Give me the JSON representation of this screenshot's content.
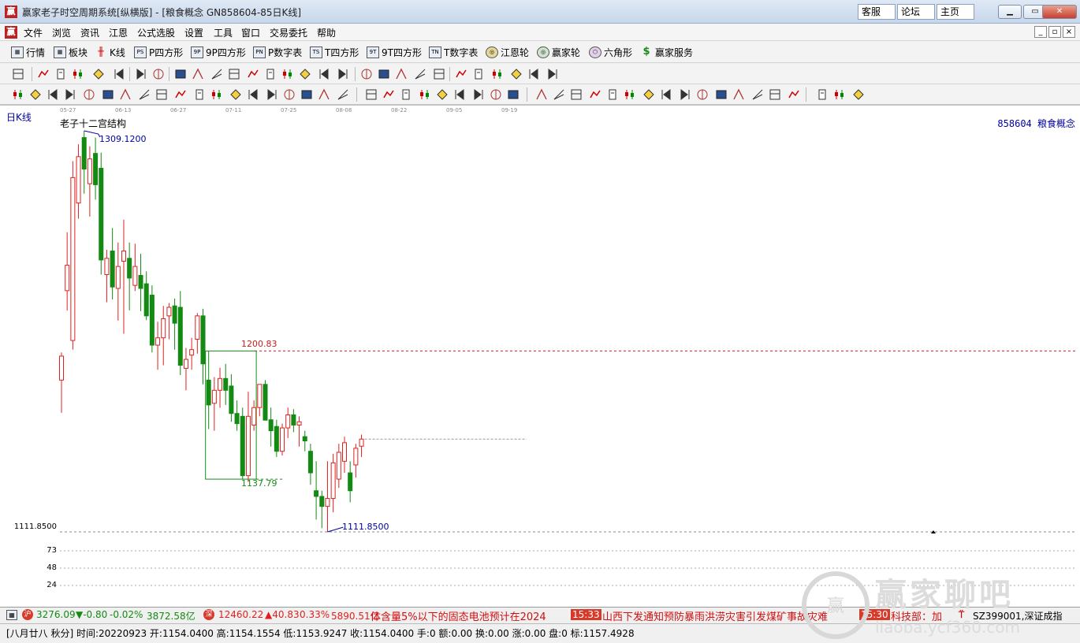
{
  "window": {
    "title": "赢家老子时空周期系统[纵横版] - [粮食概念  GN858604-85日K线]",
    "links": [
      "客服",
      "论坛",
      "主页"
    ],
    "controls": [
      "minimize",
      "restore",
      "close"
    ]
  },
  "menu": {
    "items": [
      "文件",
      "浏览",
      "资讯",
      "江恩",
      "公式选股",
      "设置",
      "工具",
      "窗口",
      "交易委托",
      "帮助"
    ]
  },
  "toolbar1": {
    "items": [
      {
        "label": "行情",
        "icon": "grid-table-icon"
      },
      {
        "label": "板块",
        "icon": "sector-grid-icon"
      },
      {
        "label": "K线",
        "icon": "candlestick-icon"
      },
      {
        "label": "P四方形",
        "icon": "ps-square-icon"
      },
      {
        "label": "9P四方形",
        "icon": "9p-square-icon"
      },
      {
        "label": "P数字表",
        "icon": "pn-table-icon"
      },
      {
        "label": "T四方形",
        "icon": "ts-square-icon"
      },
      {
        "label": "9T四方形",
        "icon": "9t-square-icon"
      },
      {
        "label": "T数字表",
        "icon": "tn-table-icon"
      },
      {
        "label": "江恩轮",
        "icon": "gann-wheel-icon"
      },
      {
        "label": "赢家轮",
        "icon": "winner-wheel-icon"
      },
      {
        "label": "六角形",
        "icon": "hexagon-icon"
      },
      {
        "label": "赢家服务",
        "icon": "dollar-icon"
      }
    ]
  },
  "chart": {
    "period_label": "日K线",
    "indicator_name": "老子十二宫结构",
    "code_label": "858604  粮食概念",
    "dates": [
      "05-27",
      "06-13",
      "06-27",
      "07-11",
      "07-25",
      "08-08",
      "08-22",
      "09-05",
      "09-19"
    ],
    "high_label": "1309.1200",
    "low_label": "1111.8500",
    "box_top_label": "1200.83",
    "box_bottom_label": "1137.79",
    "axis_low_label": "1111.8500",
    "axis_labels": [
      "73",
      "48",
      "24"
    ]
  },
  "chart_data": {
    "type": "candlestick",
    "title": "老子十二宫结构",
    "xlabel": "",
    "ylabel": "",
    "x_ticks": [
      "05-27",
      "06-13",
      "06-27",
      "07-11",
      "07-25",
      "08-08",
      "08-22",
      "09-05",
      "09-19"
    ],
    "ylim": [
      1111.85,
      1309.12
    ],
    "reference_lines": [
      {
        "label": "1200.83",
        "value": 1200.83,
        "color": "#c81e1e",
        "style": "dashed"
      },
      {
        "label": "1111.8500",
        "value": 1111.85,
        "color": "#888888",
        "style": "dashed"
      }
    ],
    "box": {
      "top": 1200.83,
      "bottom": 1137.79,
      "color": "#1a8a1a"
    },
    "annotations": [
      {
        "label": "1309.1200",
        "value": 1309.12,
        "type": "high"
      },
      {
        "label": "1111.8500",
        "value": 1111.85,
        "type": "low"
      },
      {
        "label": "1200.83",
        "value": 1200.83,
        "type": "box-top"
      },
      {
        "label": "1137.79",
        "value": 1137.79,
        "type": "box-bottom"
      }
    ],
    "candles": [
      {
        "o": 1186.5,
        "h": 1200.1,
        "l": 1170.4,
        "c": 1198.3
      },
      {
        "o": 1230.5,
        "h": 1259.2,
        "l": 1220.7,
        "c": 1243.0
      },
      {
        "o": 1206.0,
        "h": 1294.2,
        "l": 1201.5,
        "c": 1286.1
      },
      {
        "o": 1273.6,
        "h": 1302.5,
        "l": 1265.9,
        "c": 1296.4
      },
      {
        "o": 1305.8,
        "h": 1309.12,
        "l": 1278.2,
        "c": 1290.3
      },
      {
        "o": 1283.1,
        "h": 1301.5,
        "l": 1266.9,
        "c": 1295.3
      },
      {
        "o": 1298.0,
        "h": 1305.8,
        "l": 1275.3,
        "c": 1282.6
      },
      {
        "o": 1290.7,
        "h": 1298.4,
        "l": 1238.4,
        "c": 1245.6
      },
      {
        "o": 1238.4,
        "h": 1250.6,
        "l": 1224.8,
        "c": 1246.4
      },
      {
        "o": 1250.0,
        "h": 1261.3,
        "l": 1226.2,
        "c": 1232.3
      },
      {
        "o": 1231.6,
        "h": 1254.2,
        "l": 1215.8,
        "c": 1242.4
      },
      {
        "o": 1245.0,
        "h": 1265.4,
        "l": 1209.3,
        "c": 1250.0
      },
      {
        "o": 1246.4,
        "h": 1254.2,
        "l": 1220.8,
        "c": 1236.7
      },
      {
        "o": 1233.1,
        "h": 1253.6,
        "l": 1230.3,
        "c": 1242.4
      },
      {
        "o": 1238.0,
        "h": 1248.6,
        "l": 1220.4,
        "c": 1231.6
      },
      {
        "o": 1233.9,
        "h": 1240.0,
        "l": 1216.0,
        "c": 1218.1
      },
      {
        "o": 1228.3,
        "h": 1233.1,
        "l": 1200.1,
        "c": 1203.7
      },
      {
        "o": 1203.7,
        "h": 1215.2,
        "l": 1191.6,
        "c": 1207.3
      },
      {
        "o": 1207.3,
        "h": 1223.0,
        "l": 1193.8,
        "c": 1216.7
      },
      {
        "o": 1218.1,
        "h": 1224.4,
        "l": 1206.6,
        "c": 1222.3
      },
      {
        "o": 1223.0,
        "h": 1226.6,
        "l": 1201.5,
        "c": 1214.5
      },
      {
        "o": 1222.3,
        "h": 1230.3,
        "l": 1189.0,
        "c": 1193.8
      },
      {
        "o": 1192.3,
        "h": 1202.3,
        "l": 1181.5,
        "c": 1196.7
      },
      {
        "o": 1198.8,
        "h": 1207.3,
        "l": 1191.6,
        "c": 1201.5
      },
      {
        "o": 1206.6,
        "h": 1219.5,
        "l": 1199.5,
        "c": 1218.1
      },
      {
        "o": 1218.1,
        "h": 1221.6,
        "l": 1184.4,
        "c": 1194.5
      },
      {
        "o": 1186.5,
        "h": 1200.8,
        "l": 1162.4,
        "c": 1174.3
      },
      {
        "o": 1175.1,
        "h": 1188.0,
        "l": 1161.6,
        "c": 1181.5
      },
      {
        "o": 1181.5,
        "h": 1192.6,
        "l": 1172.9,
        "c": 1187.3
      },
      {
        "o": 1187.3,
        "h": 1194.5,
        "l": 1174.3,
        "c": 1181.5
      },
      {
        "o": 1183.6,
        "h": 1189.4,
        "l": 1166.0,
        "c": 1170.1
      },
      {
        "o": 1170.1,
        "h": 1176.5,
        "l": 1161.6,
        "c": 1165.1
      },
      {
        "o": 1168.7,
        "h": 1173.0,
        "l": 1137.8,
        "c": 1139.5
      },
      {
        "o": 1139.5,
        "h": 1180.8,
        "l": 1136.4,
        "c": 1168.7
      },
      {
        "o": 1164.4,
        "h": 1176.5,
        "l": 1161.6,
        "c": 1173.0
      },
      {
        "o": 1173.0,
        "h": 1183.6,
        "l": 1168.7,
        "c": 1184.4
      },
      {
        "o": 1184.4,
        "h": 1186.5,
        "l": 1171.5,
        "c": 1166.8
      },
      {
        "o": 1167.0,
        "h": 1173.0,
        "l": 1153.8,
        "c": 1161.6
      },
      {
        "o": 1163.7,
        "h": 1167.0,
        "l": 1148.7,
        "c": 1151.5
      },
      {
        "o": 1151.5,
        "h": 1165.1,
        "l": 1149.4,
        "c": 1163.0
      },
      {
        "o": 1163.0,
        "h": 1173.0,
        "l": 1158.0,
        "c": 1169.4
      },
      {
        "o": 1169.4,
        "h": 1172.2,
        "l": 1160.9,
        "c": 1164.4
      },
      {
        "o": 1164.4,
        "h": 1168.7,
        "l": 1153.8,
        "c": 1166.0
      },
      {
        "o": 1158.7,
        "h": 1161.6,
        "l": 1151.5,
        "c": 1156.6
      },
      {
        "o": 1151.5,
        "h": 1155.2,
        "l": 1135.0,
        "c": 1140.9
      },
      {
        "o": 1132.1,
        "h": 1146.6,
        "l": 1117.9,
        "c": 1129.3
      },
      {
        "o": 1129.3,
        "h": 1132.1,
        "l": 1113.7,
        "c": 1124.4
      },
      {
        "o": 1124.4,
        "h": 1146.6,
        "l": 1111.85,
        "c": 1128.3
      },
      {
        "o": 1128.3,
        "h": 1150.3,
        "l": 1121.5,
        "c": 1145.8
      },
      {
        "o": 1137.8,
        "h": 1155.2,
        "l": 1133.5,
        "c": 1151.0
      },
      {
        "o": 1146.6,
        "h": 1158.7,
        "l": 1140.9,
        "c": 1155.7
      },
      {
        "o": 1140.9,
        "h": 1146.6,
        "l": 1126.4,
        "c": 1132.1
      },
      {
        "o": 1144.8,
        "h": 1155.2,
        "l": 1138.6,
        "c": 1153.0
      },
      {
        "o": 1154.0,
        "h": 1159.7,
        "l": 1148.7,
        "c": 1157.5
      }
    ]
  },
  "status1": {
    "sh_index": "3276.09",
    "sh_change": "▼-0.80",
    "sh_pct": "-0.02%",
    "sh_amount": "3872.58亿",
    "sz_index": "12460.22",
    "sz_change": "▲40.83",
    "sz_pct": "0.33%",
    "sz_amount": "5890.51亿",
    "news1": "体含量5%以下的固态电池预计在2024",
    "time1": "15:33",
    "news2": "山西下发通知预防暴雨洪涝灾害引发煤矿事故灾难",
    "time2": "15:30",
    "news3": "科技部：加",
    "market": "SZ399001,深证成指"
  },
  "status2": {
    "text": "[八月廿八 秋分] 时间:20220923 开:1154.0400 高:1154.1554 低:1153.9247 收:1154.0400 手:0 额:0.00 换:0.00 涨:0.00 盘:0 标:1157.4928"
  },
  "watermark": {
    "text": "赢家聊吧",
    "url": "liaoba.ycf360.com"
  },
  "colors": {
    "up": "#e02020",
    "down": "#138a13",
    "accent": "#0000a0"
  }
}
